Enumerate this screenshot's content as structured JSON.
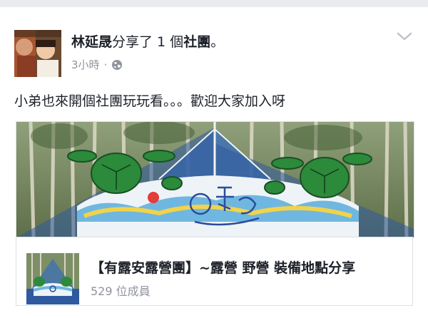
{
  "post": {
    "author": "林延晟",
    "action_prefix": "分享了 1 個",
    "action_object": "社團",
    "action_suffix": "。",
    "time": "3小時",
    "separator": "·",
    "privacy_icon": "globe-icon",
    "menu_icon": "chevron-down-icon",
    "text": "小弟也來開個社團玩玩看。。。歡迎大家加入呀"
  },
  "shared_group": {
    "title": "【有露安露營團】~露營 野營 裝備地點分享",
    "members": "529 位成員"
  },
  "colors": {
    "text": "#1d2129",
    "meta": "#90949c",
    "border": "#dddfe2",
    "page_bg": "#e9ebee"
  }
}
